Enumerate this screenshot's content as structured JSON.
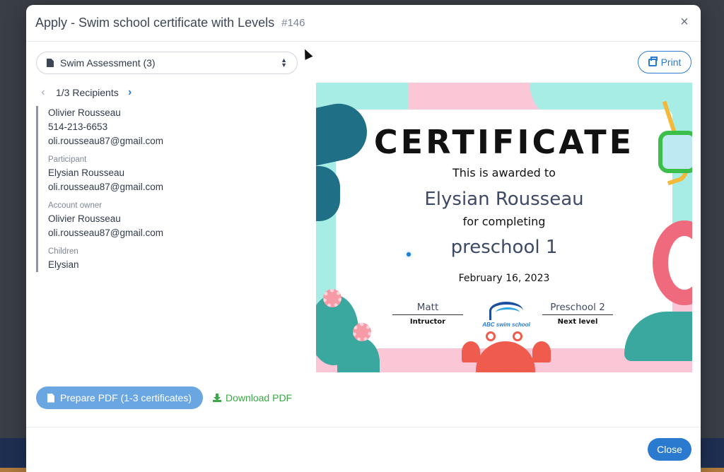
{
  "modal": {
    "title": "Apply - Swim school certificate with Levels",
    "id": "#146",
    "close_glyph": "×"
  },
  "template_select": {
    "value": "Swim Assessment (3)"
  },
  "pager": {
    "label": "1/3 Recipients",
    "prev": "‹",
    "next": "›"
  },
  "recipient": {
    "name": "Olivier Rousseau",
    "phone": "514-213-6653",
    "email": "oli.rousseau87@gmail.com",
    "participant_label": "Participant",
    "participant_name": "Elysian Rousseau",
    "participant_email": "oli.rousseau87@gmail.com",
    "owner_label": "Account owner",
    "owner_name": "Olivier Rousseau",
    "owner_email": "oli.rousseau87@gmail.com",
    "children_label": "Children",
    "children_value": "Elysian"
  },
  "print_button": {
    "label": "Print"
  },
  "certificate": {
    "title": "CERTIFICATE",
    "awarded": "This is awarded to",
    "name": "Elysian Rousseau",
    "completing": "for completing",
    "level": "preschool 1",
    "date": "February 16, 2023",
    "left_sig_value": "Matt",
    "left_sig_label": "Intructor",
    "right_sig_value": "Preschool 2",
    "right_sig_label": "Next level",
    "logo_text": "ABC swim school"
  },
  "actions": {
    "prepare_label": "Prepare PDF (1-3 certificates)",
    "download_label": "Download PDF"
  },
  "footer": {
    "close_label": "Close"
  },
  "colors": {
    "primary": "#2a7bd0",
    "prepare_bg": "#6aa7e2",
    "download": "#3aa845",
    "cert_pink": "#fbc6d6",
    "cert_mint": "#a8ece6"
  },
  "icons": {
    "select": "document-icon",
    "sort": "sort-arrows-icon",
    "print": "printer-icon",
    "prepare": "pdf-file-icon",
    "download": "download-icon",
    "close": "close-icon"
  }
}
